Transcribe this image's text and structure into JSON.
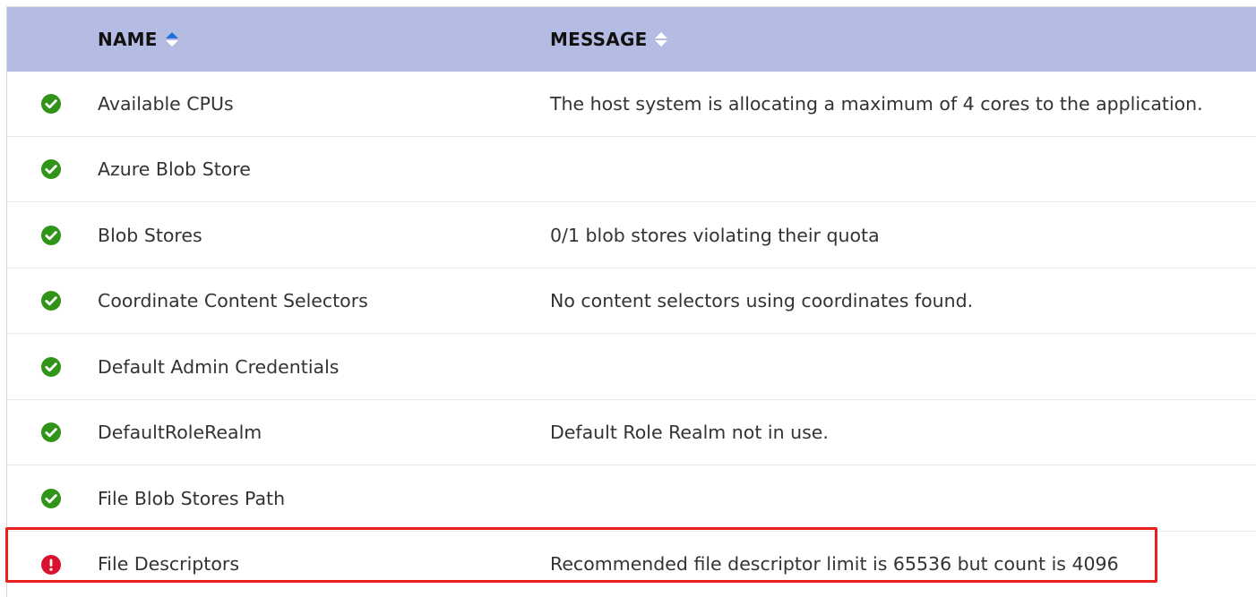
{
  "table": {
    "columns": [
      {
        "label": "NAME",
        "sort": "ascending"
      },
      {
        "label": "MESSAGE",
        "sort": "none"
      }
    ],
    "rows": [
      {
        "status": "ok",
        "status_icon": "check-circle-icon",
        "name": "Available CPUs",
        "message": "The host system is allocating a maximum of 4 cores to the application."
      },
      {
        "status": "ok",
        "status_icon": "check-circle-icon",
        "name": "Azure Blob Store",
        "message": ""
      },
      {
        "status": "ok",
        "status_icon": "check-circle-icon",
        "name": "Blob Stores",
        "message": "0/1 blob stores violating their quota"
      },
      {
        "status": "ok",
        "status_icon": "check-circle-icon",
        "name": "Coordinate Content Selectors",
        "message": "No content selectors using coordinates found."
      },
      {
        "status": "ok",
        "status_icon": "check-circle-icon",
        "name": "Default Admin Credentials",
        "message": ""
      },
      {
        "status": "ok",
        "status_icon": "check-circle-icon",
        "name": "DefaultRoleRealm",
        "message": "Default Role Realm not in use."
      },
      {
        "status": "ok",
        "status_icon": "check-circle-icon",
        "name": "File Blob Stores Path",
        "message": ""
      },
      {
        "status": "error",
        "status_icon": "error-circle-icon",
        "name": "File Descriptors",
        "message": "Recommended file descriptor limit is 65536 but count is 4096"
      }
    ]
  },
  "colors": {
    "header_bg": "#b4bce3",
    "ok": "#2f9418",
    "error": "#d9122f",
    "sort_active": "#1e6fd9",
    "highlight_border": "#e8201d"
  }
}
